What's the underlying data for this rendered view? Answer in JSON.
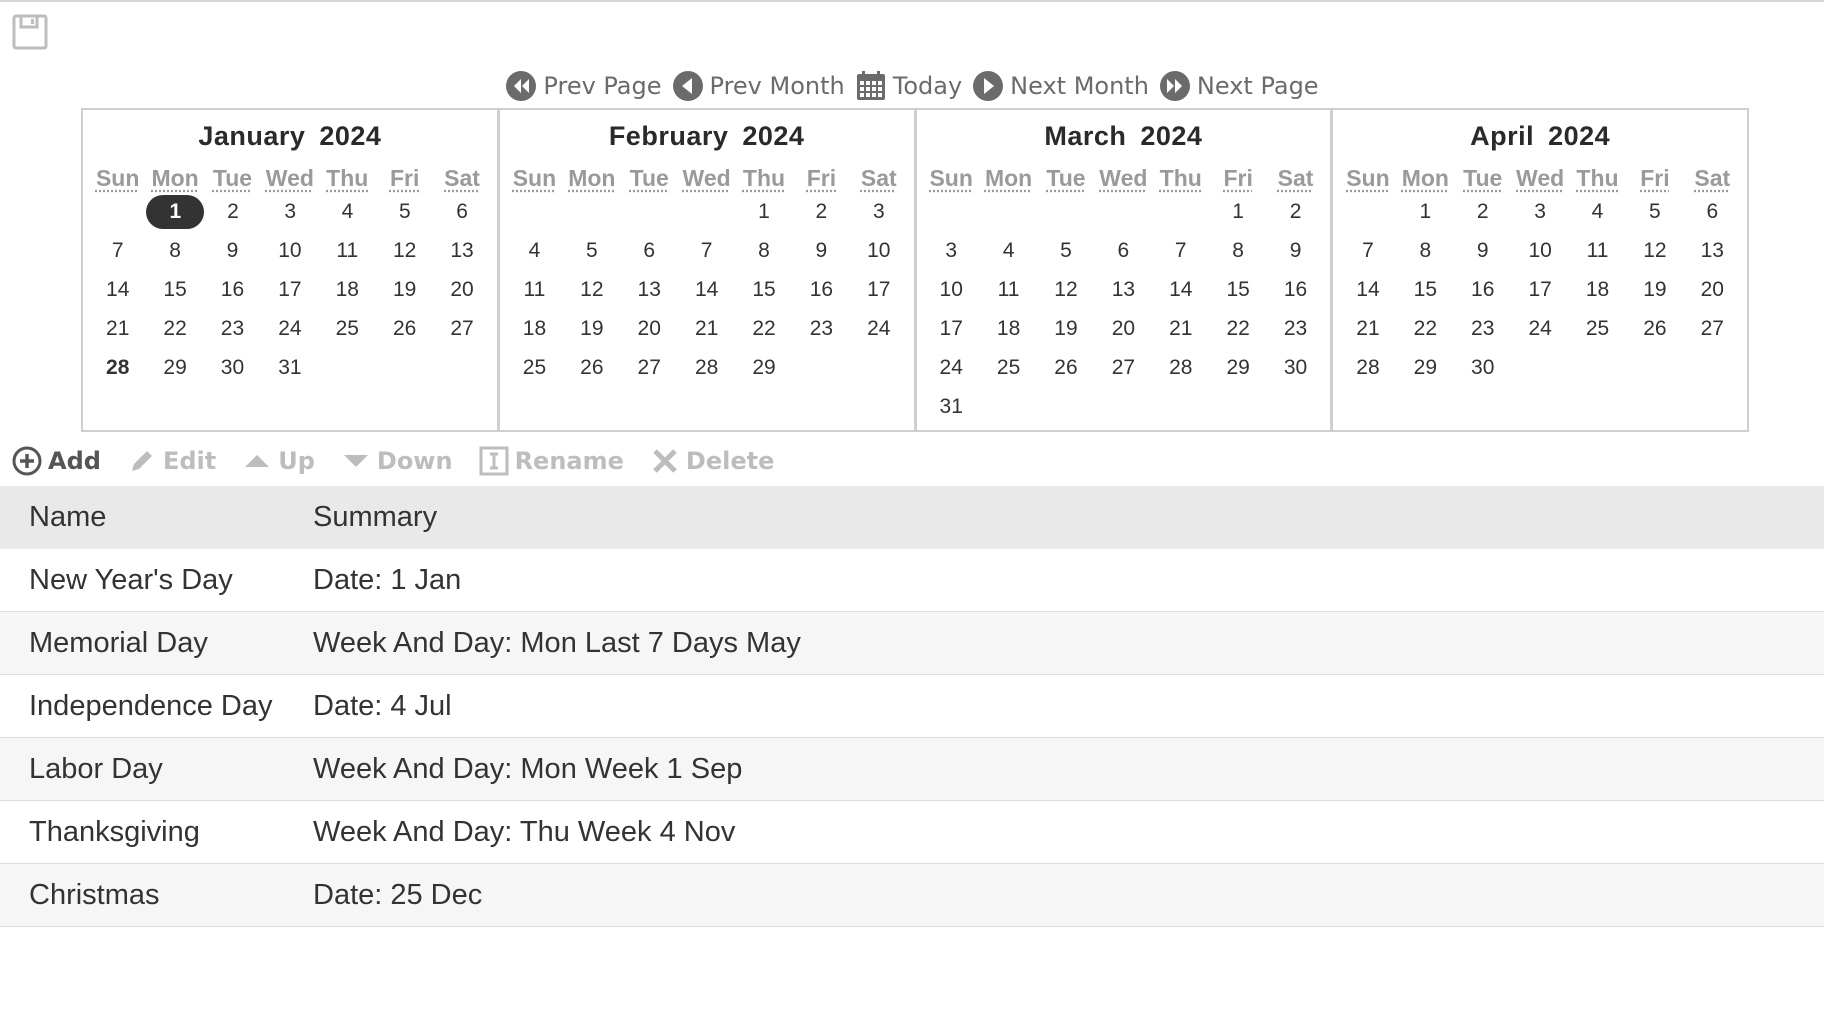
{
  "nav": {
    "prev_page": "Prev Page",
    "prev_month": "Prev Month",
    "today": "Today",
    "next_month": "Next Month",
    "next_page": "Next Page"
  },
  "day_headers": [
    "Sun",
    "Mon",
    "Tue",
    "Wed",
    "Thu",
    "Fri",
    "Sat"
  ],
  "months": [
    {
      "title": "January 2024",
      "weeks": [
        [
          "",
          "1",
          "2",
          "3",
          "4",
          "5",
          "6"
        ],
        [
          "7",
          "8",
          "9",
          "10",
          "11",
          "12",
          "13"
        ],
        [
          "14",
          "15",
          "16",
          "17",
          "18",
          "19",
          "20"
        ],
        [
          "21",
          "22",
          "23",
          "24",
          "25",
          "26",
          "27"
        ],
        [
          "28",
          "29",
          "30",
          "31",
          "",
          "",
          ""
        ]
      ]
    },
    {
      "title": "February 2024",
      "weeks": [
        [
          "",
          "",
          "",
          "",
          "1",
          "2",
          "3"
        ],
        [
          "4",
          "5",
          "6",
          "7",
          "8",
          "9",
          "10"
        ],
        [
          "11",
          "12",
          "13",
          "14",
          "15",
          "16",
          "17"
        ],
        [
          "18",
          "19",
          "20",
          "21",
          "22",
          "23",
          "24"
        ],
        [
          "25",
          "26",
          "27",
          "28",
          "29",
          "",
          ""
        ]
      ]
    },
    {
      "title": "March 2024",
      "weeks": [
        [
          "",
          "",
          "",
          "",
          "",
          "1",
          "2"
        ],
        [
          "3",
          "4",
          "5",
          "6",
          "7",
          "8",
          "9"
        ],
        [
          "10",
          "11",
          "12",
          "13",
          "14",
          "15",
          "16"
        ],
        [
          "17",
          "18",
          "19",
          "20",
          "21",
          "22",
          "23"
        ],
        [
          "24",
          "25",
          "26",
          "27",
          "28",
          "29",
          "30"
        ],
        [
          "31",
          "",
          "",
          "",
          "",
          "",
          ""
        ]
      ]
    },
    {
      "title": "April 2024",
      "weeks": [
        [
          "",
          "1",
          "2",
          "3",
          "4",
          "5",
          "6"
        ],
        [
          "7",
          "8",
          "9",
          "10",
          "11",
          "12",
          "13"
        ],
        [
          "14",
          "15",
          "16",
          "17",
          "18",
          "19",
          "20"
        ],
        [
          "21",
          "22",
          "23",
          "24",
          "25",
          "26",
          "27"
        ],
        [
          "28",
          "29",
          "30",
          "",
          "",
          "",
          ""
        ]
      ]
    }
  ],
  "today_day": "1",
  "bold_day": "28",
  "toolbar": {
    "add": "Add",
    "edit": "Edit",
    "up": "Up",
    "down": "Down",
    "rename": "Rename",
    "delete": "Delete"
  },
  "table": {
    "columns": [
      "Name",
      "Summary"
    ],
    "rows": [
      {
        "name": "New Year's Day",
        "summary": "Date: 1 Jan"
      },
      {
        "name": "Memorial Day",
        "summary": "Week And Day: Mon Last 7 Days May"
      },
      {
        "name": "Independence Day",
        "summary": "Date: 4 Jul"
      },
      {
        "name": "Labor Day",
        "summary": "Week And Day: Mon Week 1 Sep"
      },
      {
        "name": "Thanksgiving",
        "summary": "Week And Day: Thu Week 4 Nov"
      },
      {
        "name": "Christmas",
        "summary": "Date: 25 Dec"
      }
    ]
  },
  "icons": {
    "save": "floppy-disk-icon",
    "prev_page": "double-chevron-left-circle-icon",
    "prev_month": "triangle-left-circle-icon",
    "today": "calendar-grid-icon",
    "next_month": "triangle-right-circle-icon",
    "next_page": "double-chevron-right-circle-icon",
    "add": "plus-circle-icon",
    "edit": "pencil-icon",
    "up": "triangle-up-icon",
    "down": "triangle-down-icon",
    "rename": "text-cursor-box-icon",
    "delete": "x-icon"
  },
  "colors": {
    "nav_text": "#6b6b6b",
    "today_highlight": "#333333",
    "disabled_tool": "#bdbdbd",
    "header_row_bg": "#e9e9e9",
    "alt_row_bg": "#f6f6f6"
  }
}
